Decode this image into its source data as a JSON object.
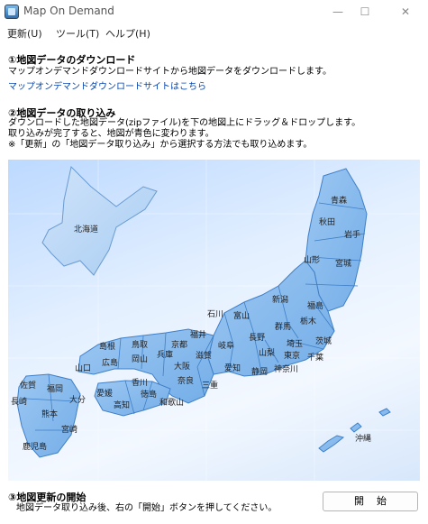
{
  "window": {
    "title": "Map On Demand",
    "controls": {
      "minimize": "—",
      "maximize": "☐",
      "close": "✕"
    }
  },
  "menu": [
    "更新(U)",
    "ツール(T)",
    "ヘルプ(H)"
  ],
  "section1": {
    "heading": "①地図データのダウンロード",
    "text": "マップオンデマンドダウンロードサイトから地図データをダウンロードします。",
    "link": "マップオンデマンドダウンロードサイトはこちら"
  },
  "section2": {
    "heading": "②地図データの取り込み",
    "lines": [
      "ダウンロードした地図データ(zipファイル)を下の地図上にドラッグ＆ドロップします。",
      "取り込みが完了すると、地図が青色に変わります。",
      "※「更新」の「地図データ取り込み」から選択する方法でも取り込めます。"
    ]
  },
  "map": {
    "regions": [
      "青森",
      "秋田",
      "岩手",
      "北海道",
      "山形",
      "宮城",
      "新潟",
      "福島",
      "石川",
      "富山",
      "長野",
      "群馬",
      "栃木",
      "茨城",
      "福井",
      "山梨",
      "埼玉",
      "東京",
      "千葉",
      "神奈川",
      "静岡",
      "愛知",
      "岐阜",
      "滋賀",
      "京都",
      "兵庫",
      "大阪",
      "奈良",
      "三重",
      "和歌山",
      "鳥取",
      "島根",
      "岡山",
      "広島",
      "山口",
      "香川",
      "徳島",
      "愛媛",
      "高知",
      "福岡",
      "佐賀",
      "長崎",
      "大分",
      "熊本",
      "宮崎",
      "鹿児島",
      "沖縄"
    ],
    "colors": {
      "land": "#7fb5ec",
      "outline": "#3f7fc7",
      "background": "#d9eaff"
    }
  },
  "section3": {
    "heading": "③地図更新の開始",
    "text": "地図データ取り込み後、右の「開始」ボタンを押してください。"
  },
  "start_button": "開始"
}
